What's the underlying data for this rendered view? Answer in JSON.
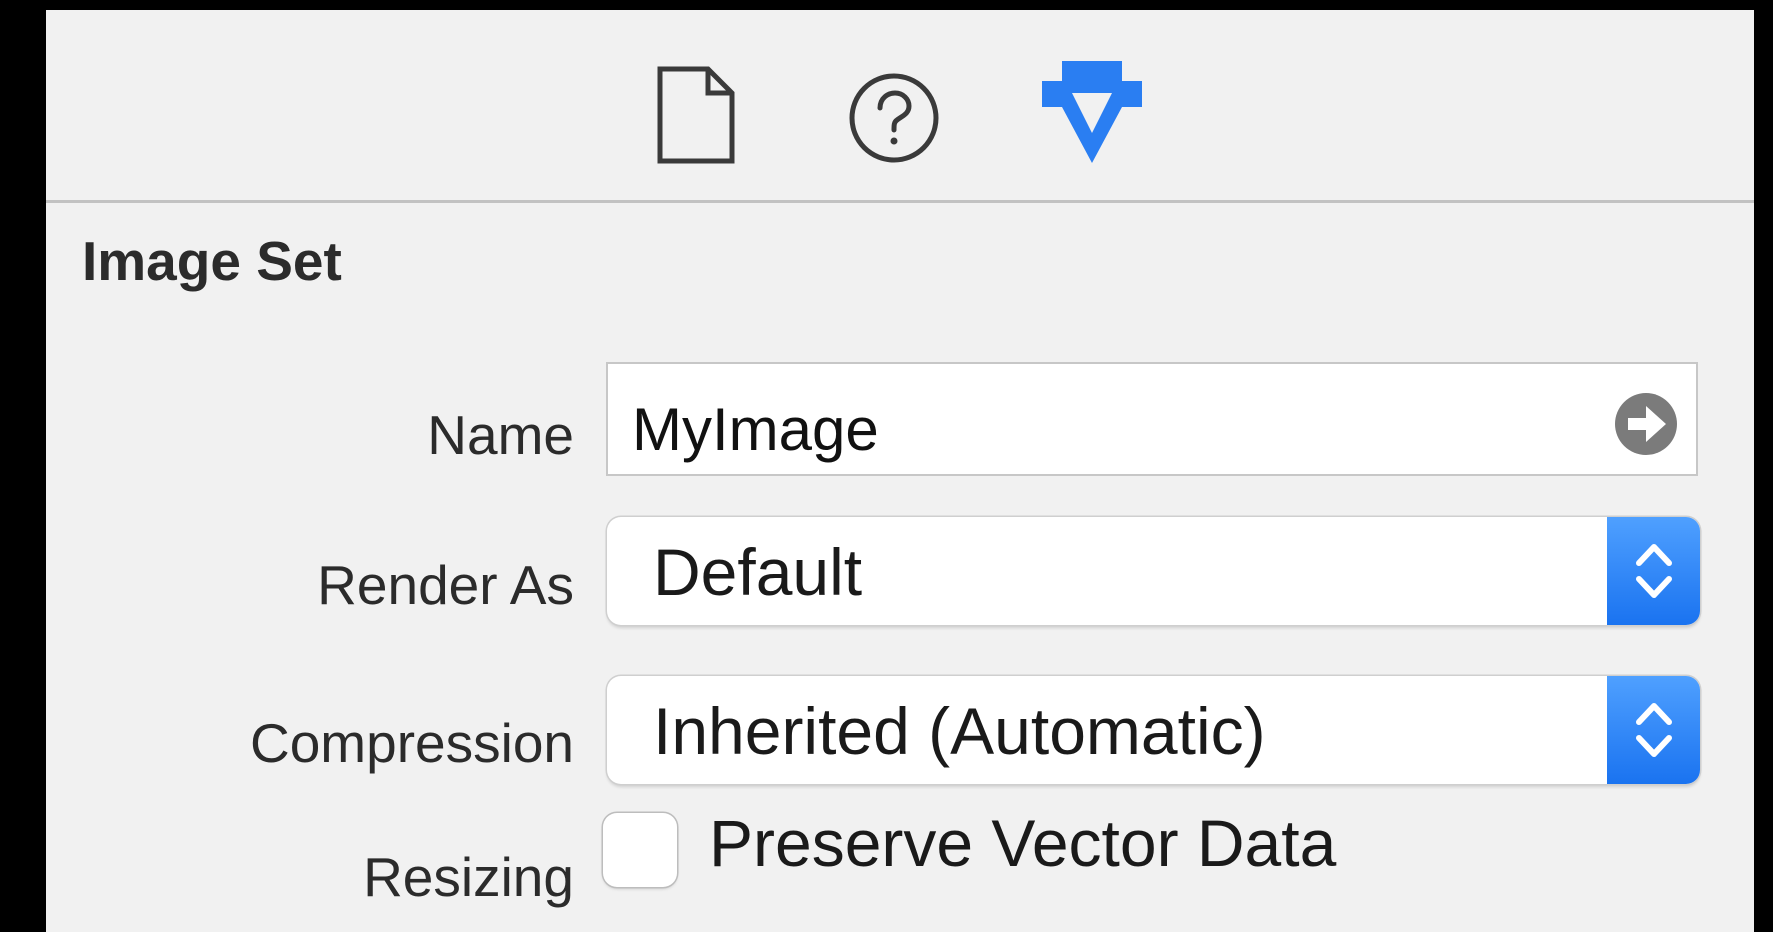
{
  "toolbar": {
    "icons": [
      "file-inspector-icon",
      "quick-help-icon",
      "attributes-inspector-icon"
    ],
    "active_color": "#2a7ef2"
  },
  "section": {
    "title": "Image Set"
  },
  "form": {
    "name": {
      "label": "Name",
      "value": "MyImage"
    },
    "render_as": {
      "label": "Render As",
      "value": "Default"
    },
    "compression": {
      "label": "Compression",
      "value": "Inherited (Automatic)"
    },
    "resizing": {
      "label": "Resizing",
      "checkbox_label": "Preserve Vector Data",
      "checked": false
    }
  },
  "colors": {
    "panel_background": "#f1f1f1",
    "accent": "#2a7ef2"
  }
}
